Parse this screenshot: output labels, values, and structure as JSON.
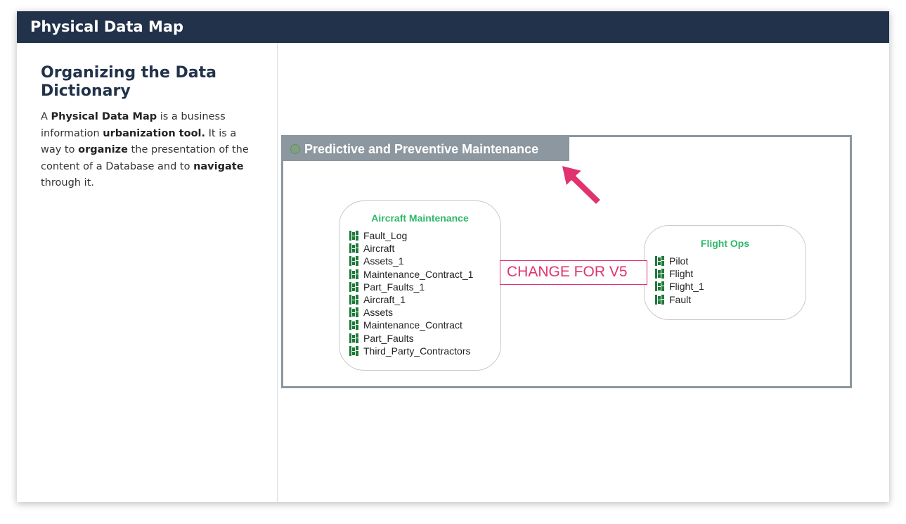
{
  "header": {
    "title": "Physical Data Map"
  },
  "left_panel": {
    "title": "Organizing the Data Dictionary",
    "description": [
      {
        "text": "A ",
        "bold": false
      },
      {
        "text": "Physical Data Map",
        "bold": true
      },
      {
        "text": " is a business information ",
        "bold": false
      },
      {
        "text": "urbanization tool.",
        "bold": true
      },
      {
        "text": " It is a way to ",
        "bold": false
      },
      {
        "text": "organize",
        "bold": true
      },
      {
        "text": " the presentation of the content of a Database and to ",
        "bold": false
      },
      {
        "text": "navigate",
        "bold": true
      },
      {
        "text": " through it.",
        "bold": false
      }
    ]
  },
  "map": {
    "title": "Predictive and Preventive Maintenance",
    "domains": [
      {
        "name": "Aircraft Maintenance",
        "tables": [
          "Fault_Log",
          "Aircraft",
          "Assets_1",
          "Maintenance_Contract_1",
          "Part_Faults_1",
          "Aircraft_1",
          "Assets",
          "Maintenance_Contract",
          "Part_Faults",
          "Third_Party_Contractors"
        ]
      },
      {
        "name": "Flight Ops",
        "tables": [
          "Pilot",
          "Flight",
          "Flight_1",
          "Fault"
        ]
      }
    ],
    "connector_label": "CHANGE FOR V5",
    "icons": {
      "table": "table-icon",
      "map_dot": "status-dot-icon",
      "annotation_arrow": "arrow-icon"
    },
    "colors": {
      "header_bg": "#21324a",
      "map_border": "#8c979f",
      "domain_title": "#2fb86b",
      "table_icon": "#1f7a3a",
      "annotation": "#e0336f"
    }
  }
}
